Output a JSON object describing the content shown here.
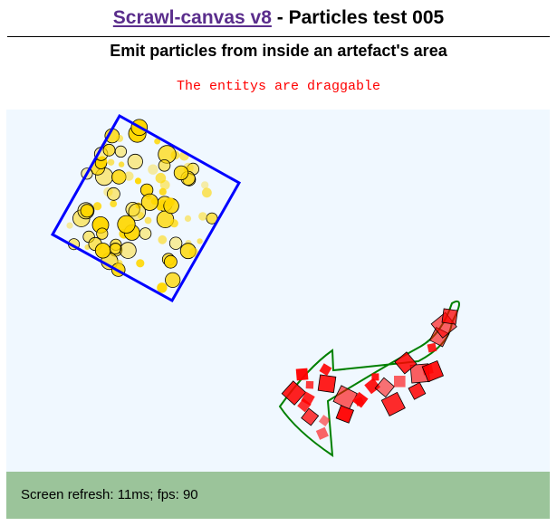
{
  "header": {
    "link_text": "Scrawl-canvas v8",
    "title_rest": " - Particles test 005",
    "subtitle": "Emit particles from inside an artefact's area",
    "note": "The entitys are draggable",
    "link_color": "#5a2d8c",
    "note_color": "#ff0000"
  },
  "canvas": {
    "background": "#f0f8ff",
    "square_entity": {
      "stroke": "#0000ff",
      "particle_fill": "#ffd700",
      "particle_stroke": "#000000"
    },
    "arrow_entity": {
      "stroke": "#008000",
      "particle_fill": "#ff0000",
      "particle_stroke": "#000000"
    }
  },
  "report": {
    "text": "Screen refresh: 11ms; fps: 90",
    "background": "#9bc49a"
  }
}
